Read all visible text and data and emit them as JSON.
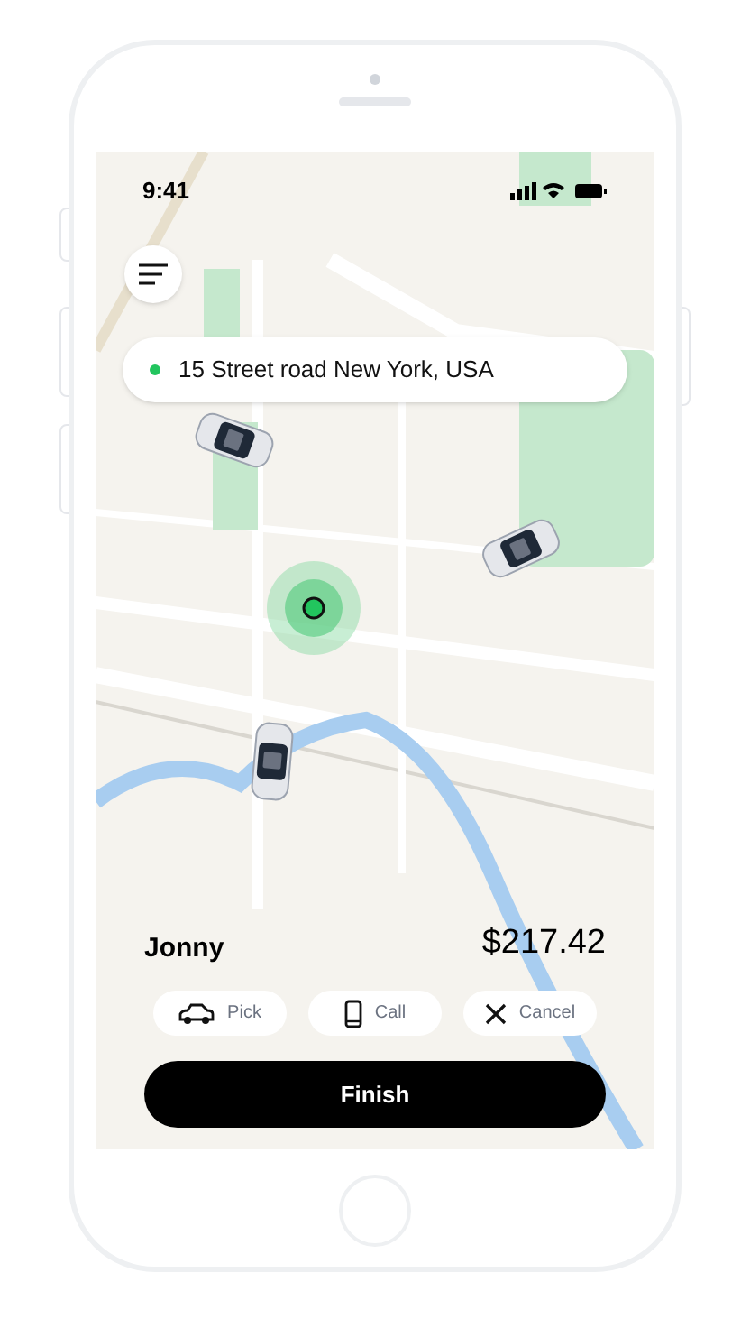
{
  "status_bar": {
    "time": "9:41"
  },
  "destination": {
    "value": "15 Street road New York, USA"
  },
  "trip": {
    "rider": "Jonny",
    "fare": "$217.42"
  },
  "actions": [
    {
      "kind": "pick",
      "label": "Pick"
    },
    {
      "kind": "call",
      "label": "Call"
    },
    {
      "kind": "cancel",
      "label": "Cancel"
    }
  ],
  "primary_button": {
    "label": "Finish"
  }
}
